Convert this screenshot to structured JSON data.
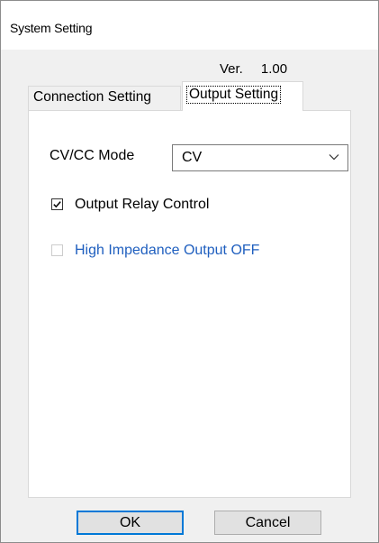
{
  "window": {
    "title": "System Setting"
  },
  "version": {
    "label": "Ver.",
    "value": "1.00"
  },
  "tabs": [
    {
      "label": "Connection Setting",
      "selected": false
    },
    {
      "label": "Output Setting",
      "selected": true
    }
  ],
  "output_setting": {
    "mode_label": "CV/CC Mode",
    "mode_value": "CV",
    "output_relay_control": {
      "label": "Output Relay Control",
      "checked": true,
      "enabled": true
    },
    "high_impedance_output_off": {
      "label": "High Impedance Output OFF",
      "checked": false,
      "enabled": false
    }
  },
  "buttons": {
    "ok_label": "OK",
    "cancel_label": "Cancel"
  },
  "colors": {
    "dialog_background": "#f0f0f0",
    "panel_background": "#ffffff",
    "default_button_border": "#0078d7",
    "disabled_label_text": "#1f5fbf"
  }
}
